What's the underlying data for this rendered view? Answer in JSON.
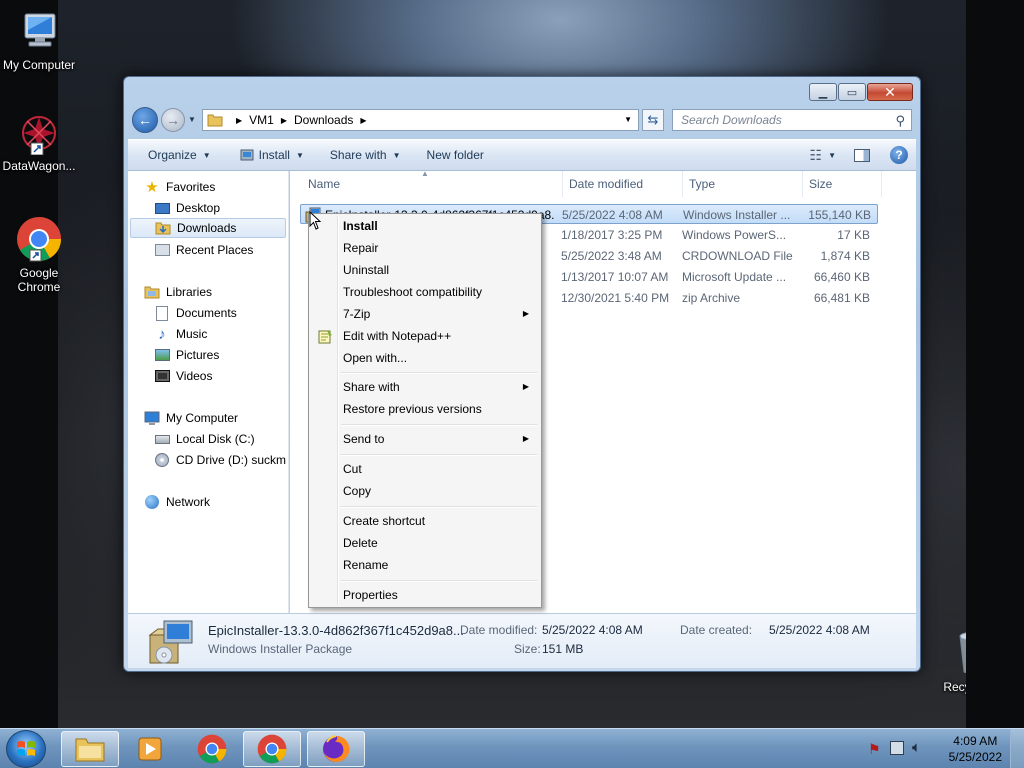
{
  "desktop": {
    "icons": [
      {
        "label": "My Computer",
        "icon": "computer-icon"
      },
      {
        "label": "DataWagon...",
        "icon": "datawagon-icon"
      },
      {
        "label": "Google Chrome",
        "icon": "chrome-icon"
      },
      {
        "label": "Recycle Bin",
        "icon": "recycle-bin-icon"
      }
    ]
  },
  "window": {
    "address": {
      "segments": [
        "VM1",
        "Downloads"
      ]
    },
    "search_placeholder": "Search Downloads",
    "toolbar": {
      "organize": "Organize",
      "install": "Install",
      "share_with": "Share with",
      "new_folder": "New folder"
    },
    "nav": {
      "favorites": "Favorites",
      "desktop": "Desktop",
      "downloads": "Downloads",
      "recent_places": "Recent Places",
      "libraries": "Libraries",
      "documents": "Documents",
      "music": "Music",
      "pictures": "Pictures",
      "videos": "Videos",
      "my_computer": "My Computer",
      "local_disk": "Local Disk (C:)",
      "cd_drive": "CD Drive (D:) suckm",
      "network": "Network"
    },
    "columns": {
      "name": "Name",
      "date": "Date modified",
      "type": "Type",
      "size": "Size"
    },
    "files": [
      {
        "name": "EpicInstaller-13.3.0-4d862f367f1c452d9a8...",
        "date": "5/25/2022 4:08 AM",
        "type": "Windows Installer ...",
        "size": "155,140 KB"
      },
      {
        "name": "",
        "date": "1/18/2017 3:25 PM",
        "type": "Windows PowerS...",
        "size": "17 KB"
      },
      {
        "name": "",
        "date": "5/25/2022 3:48 AM",
        "type": "CRDOWNLOAD File",
        "size": "1,874 KB"
      },
      {
        "name": "",
        "date": "1/13/2017 10:07 AM",
        "type": "Microsoft Update ...",
        "size": "66,460 KB"
      },
      {
        "name": "",
        "date": "12/30/2021 5:40 PM",
        "type": "zip Archive",
        "size": "66,481 KB"
      }
    ],
    "details": {
      "filename": "EpicInstaller-13.3.0-4d862f367f1c452d9a8...",
      "filetype": "Windows Installer Package",
      "date_modified_label": "Date modified:",
      "date_modified": "5/25/2022 4:08 AM",
      "size_label": "Size:",
      "size": "151 MB",
      "date_created_label": "Date created:",
      "date_created": "5/25/2022 4:08 AM"
    }
  },
  "context_menu": {
    "install": "Install",
    "repair": "Repair",
    "uninstall": "Uninstall",
    "troubleshoot": "Troubleshoot compatibility",
    "seven_zip": "7-Zip",
    "edit_notepad": "Edit with Notepad++",
    "open_with": "Open with...",
    "share_with": "Share with",
    "restore": "Restore previous versions",
    "send_to": "Send to",
    "cut": "Cut",
    "copy": "Copy",
    "create_shortcut": "Create shortcut",
    "delete": "Delete",
    "rename": "Rename",
    "properties": "Properties"
  },
  "taskbar": {
    "time": "4:09 AM",
    "date": "5/25/2022"
  }
}
